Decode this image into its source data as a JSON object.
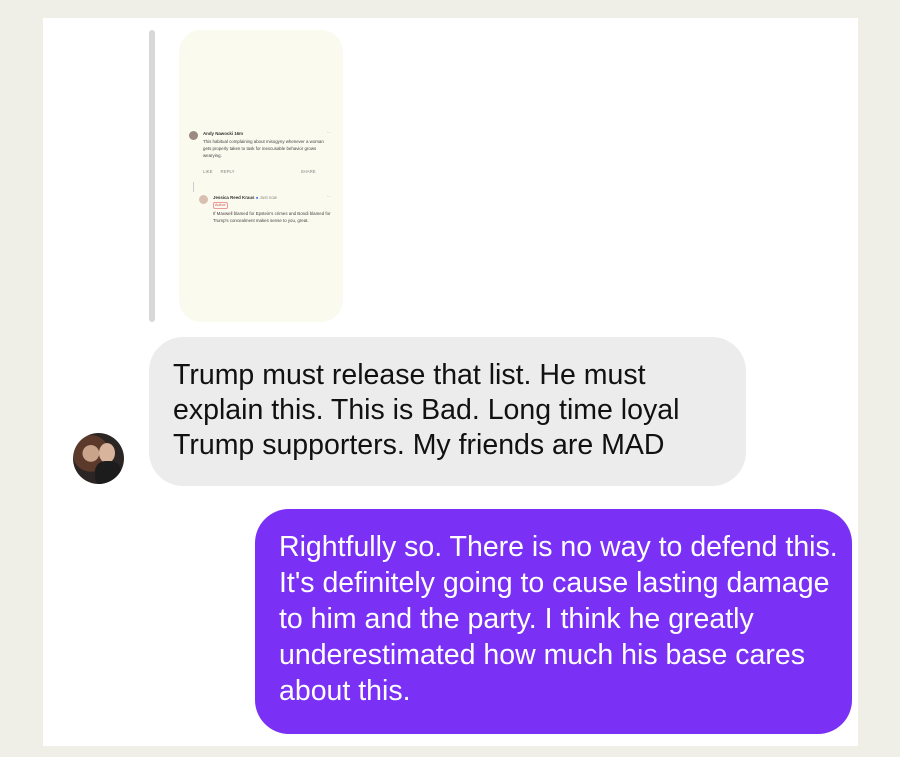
{
  "shared_post": {
    "post1": {
      "author": "Andy Nawocki",
      "meta": "Andy Nawocki 16m",
      "text": "This habitual complaining about misogyny whenever a woman gets properly taken to task for inexcusable behavior grows wearying.",
      "actions": [
        "LIKE",
        "REPLY",
        "SHARE"
      ]
    },
    "post2": {
      "author": "Jessica Reed Kraus",
      "meta": "Just now",
      "badge": "Author",
      "text": "If Maxwell blamed for Epstein's crimes and Bondi blamed for Trump's concealment makes sense to you, great."
    }
  },
  "messages": [
    {
      "direction": "incoming",
      "text": "Trump must release that list.  He must explain this.  This is Bad. Long time loyal Trump supporters. My friends are MAD"
    },
    {
      "direction": "outgoing",
      "text": "Rightfully so. There is no way to defend this. It's definitely going to cause lasting damage to him and the party. I think he greatly underestimated how much his base cares about this."
    }
  ],
  "colors": {
    "incoming_bubble": "#ececec",
    "outgoing_bubble": "#7a30f5",
    "background": "#efefe8"
  }
}
